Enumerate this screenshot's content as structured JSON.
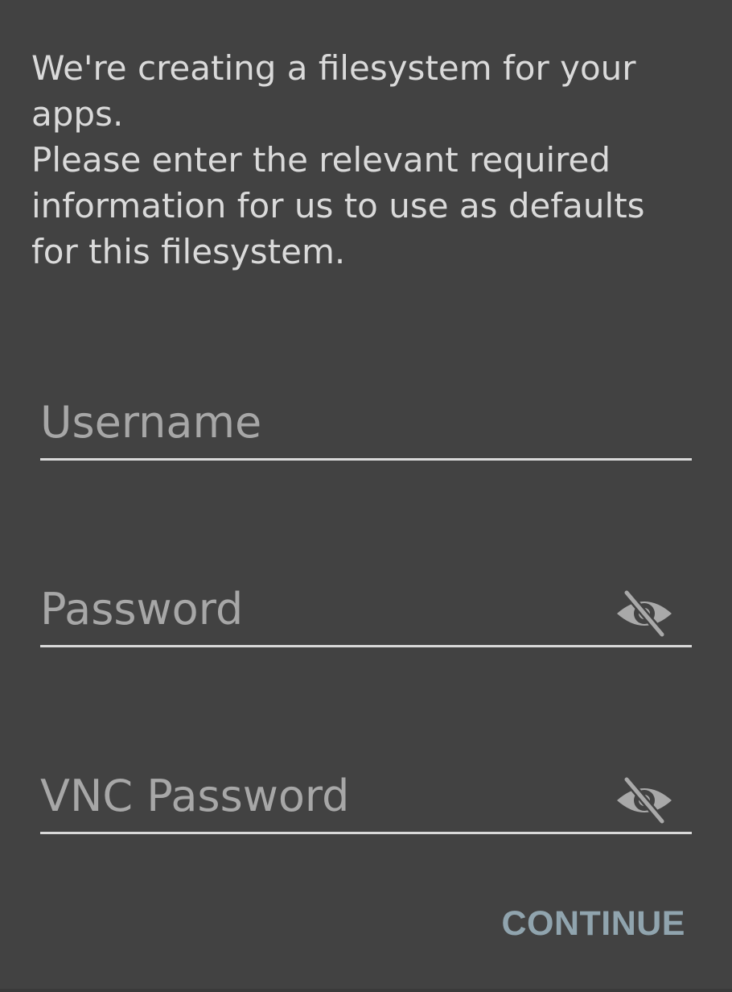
{
  "dialog": {
    "message_lines": [
      "We're creating a filesystem for your",
      "apps.",
      "Please enter the relevant required",
      "information for us to use as defaults",
      "for this filesystem."
    ]
  },
  "fields": {
    "username": {
      "placeholder": "Username",
      "value": ""
    },
    "password": {
      "placeholder": "Password",
      "value": "",
      "toggle_icon": "visibility-off-icon"
    },
    "vnc_password": {
      "placeholder": "VNC Password",
      "value": "",
      "toggle_icon": "visibility-off-icon"
    }
  },
  "actions": {
    "continue_label": "CONTINUE"
  },
  "colors": {
    "background": "#424242",
    "text": "#dadada",
    "placeholder": "#a7a7a7",
    "underline": "#d9d9d9",
    "accent": "#90a4ae"
  }
}
